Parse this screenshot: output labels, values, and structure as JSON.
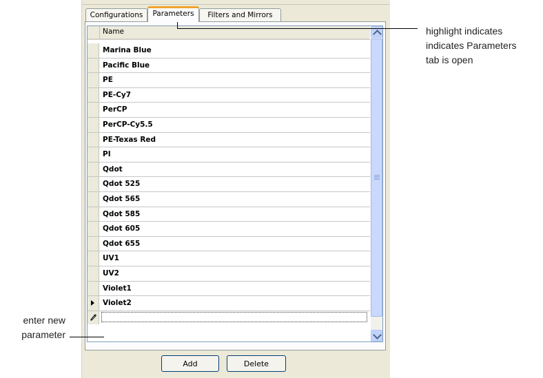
{
  "tabs": [
    {
      "label": "Configurations"
    },
    {
      "label": "Parameters"
    },
    {
      "label": "Filters and Mirrors"
    }
  ],
  "grid": {
    "column_header": "Name",
    "rows": [
      {
        "name": "Marina Blue"
      },
      {
        "name": "Pacific Blue"
      },
      {
        "name": "PE"
      },
      {
        "name": "PE-Cy7"
      },
      {
        "name": "PerCP"
      },
      {
        "name": "PerCP-Cy5.5"
      },
      {
        "name": "PE-Texas Red"
      },
      {
        "name": "PI"
      },
      {
        "name": "Qdot"
      },
      {
        "name": "Qdot 525"
      },
      {
        "name": "Qdot 565"
      },
      {
        "name": "Qdot 585"
      },
      {
        "name": "Qdot 605"
      },
      {
        "name": "Qdot 655"
      },
      {
        "name": "UV1"
      },
      {
        "name": "UV2"
      },
      {
        "name": "Violet1"
      },
      {
        "name": "Violet2"
      }
    ],
    "current_row": "Violet2",
    "new_row_value": ""
  },
  "buttons": {
    "add_label": "Add",
    "delete_label": "Delete"
  },
  "callouts": {
    "tab_highlight_line1": "highlight indicates",
    "tab_highlight_line2": "indicates Parameters",
    "tab_highlight_line3": "tab is open",
    "enter_new_line1": "enter new",
    "enter_new_line2": "parameter"
  },
  "colors": {
    "active_tab_highlight": "#f0a22c",
    "scrollbar": "#c9d8fc"
  }
}
